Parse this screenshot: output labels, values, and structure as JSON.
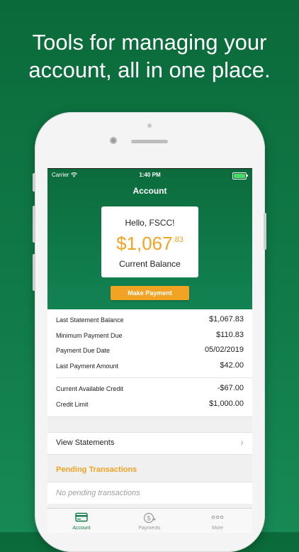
{
  "headline": "Tools for managing your\naccount, all in one place.",
  "status_bar": {
    "carrier": "Carrier",
    "time": "1:40 PM"
  },
  "nav": {
    "title": "Account"
  },
  "summary": {
    "greeting": "Hello, FSCC!",
    "balance_main": "$1,067",
    "balance_cents": ".83",
    "balance_label": "Current Balance",
    "make_payment": "Make Payment"
  },
  "details": [
    {
      "label": "Last Statement Balance",
      "value": "$1,067.83"
    },
    {
      "label": "Minimum Payment Due",
      "value": "$110.83"
    },
    {
      "label": "Payment Due Date",
      "value": "05/02/2019"
    },
    {
      "label": "Last Payment Amount",
      "value": "$42.00"
    }
  ],
  "credit": [
    {
      "label": "Current Available Credit",
      "value": "-$67.00"
    },
    {
      "label": "Credit Limit",
      "value": "$1,000.00"
    }
  ],
  "view_statements": "View Statements",
  "pending": {
    "title": "Pending Transactions",
    "empty": "No pending transactions"
  },
  "tabs": [
    {
      "label": "Account",
      "icon": "credit-card-icon",
      "active": true
    },
    {
      "label": "Payments",
      "icon": "dollar-arrow-icon",
      "active": false
    },
    {
      "label": "More",
      "icon": "more-dots-icon",
      "active": false
    }
  ],
  "colors": {
    "brand_green": "#0f7a4a",
    "accent_orange": "#f2a324"
  }
}
